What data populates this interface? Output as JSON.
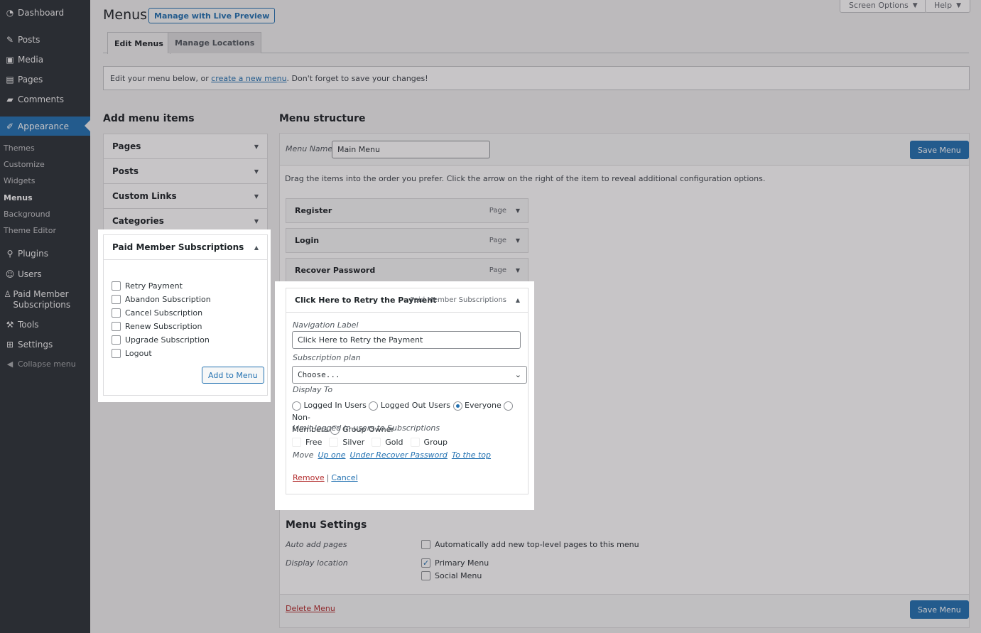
{
  "sidebar": {
    "items": [
      {
        "label": "Dashboard",
        "icon": "dashboard-icon"
      },
      {
        "label": "Posts",
        "icon": "pushpin-icon"
      },
      {
        "label": "Media",
        "icon": "media-icon"
      },
      {
        "label": "Pages",
        "icon": "pages-icon"
      },
      {
        "label": "Comments",
        "icon": "comment-icon"
      },
      {
        "label": "Appearance",
        "icon": "paintbrush-icon"
      },
      {
        "label": "Plugins",
        "icon": "plugin-icon"
      },
      {
        "label": "Users",
        "icon": "users-icon"
      },
      {
        "label": "Paid Member Subscriptions",
        "icon": "member-icon"
      },
      {
        "label": "Tools",
        "icon": "wrench-icon"
      },
      {
        "label": "Settings",
        "icon": "settings-icon"
      },
      {
        "label": "Collapse menu",
        "icon": "collapse-icon"
      }
    ],
    "submenu": [
      "Themes",
      "Customize",
      "Widgets",
      "Menus",
      "Background",
      "Theme Editor"
    ]
  },
  "header": {
    "title": "Menus",
    "live_preview": "Manage with Live Preview",
    "screen_options": "Screen Options",
    "help": "Help"
  },
  "tabs": [
    "Edit Menus",
    "Manage Locations"
  ],
  "notice": {
    "before": "Edit your menu below, or ",
    "link": "create a new menu",
    "after": ". Don't forget to save your changes!"
  },
  "add_items": {
    "heading": "Add menu items",
    "sections": [
      "Pages",
      "Posts",
      "Custom Links",
      "Categories",
      "Paid Member Subscriptions"
    ],
    "pms_options": [
      "Retry Payment",
      "Abandon Subscription",
      "Cancel Subscription",
      "Renew Subscription",
      "Upgrade Subscription",
      "Logout"
    ],
    "add_button": "Add to Menu"
  },
  "structure": {
    "heading": "Menu structure",
    "menu_name_label": "Menu Name",
    "menu_name_value": "Main Menu",
    "save_label": "Save Menu",
    "instructions": "Drag the items into the order you prefer. Click the arrow on the right of the item to reveal additional configuration options.",
    "items": [
      {
        "title": "Register",
        "type": "Page"
      },
      {
        "title": "Login",
        "type": "Page"
      },
      {
        "title": "Recover Password",
        "type": "Page"
      },
      {
        "title": "Click Here to Retry the Payment",
        "type": "Paid Member Subscriptions"
      }
    ],
    "settings": {
      "nav_label": "Navigation Label",
      "nav_value": "Click Here to Retry the Payment",
      "plan_label": "Subscription plan",
      "plan_value": "Choose...",
      "display_label": "Display To",
      "display_options": [
        "Logged In Users",
        "Logged Out Users",
        "Everyone",
        "Non-",
        "Members",
        "Group Owner"
      ],
      "limit_label": "Limit logged in users to Subscriptions",
      "limit_options": [
        "Free",
        "Silver",
        "Gold",
        "Group"
      ],
      "move_label": "Move",
      "move_links": [
        "Up one",
        "Under Recover Password",
        "To the top"
      ],
      "remove": "Remove",
      "separator": "|",
      "cancel": "Cancel"
    }
  },
  "menu_settings": {
    "heading": "Menu Settings",
    "auto_label": "Auto add pages",
    "auto_option": "Automatically add new top-level pages to this menu",
    "location_label": "Display location",
    "locations": [
      {
        "label": "Primary Menu",
        "checked": true
      },
      {
        "label": "Social Menu",
        "checked": false
      }
    ]
  },
  "footer": {
    "delete": "Delete Menu",
    "save": "Save Menu"
  },
  "colors": {
    "accent": "#2271b1",
    "sidebar": "#2c3338",
    "danger": "#b32d2e"
  }
}
